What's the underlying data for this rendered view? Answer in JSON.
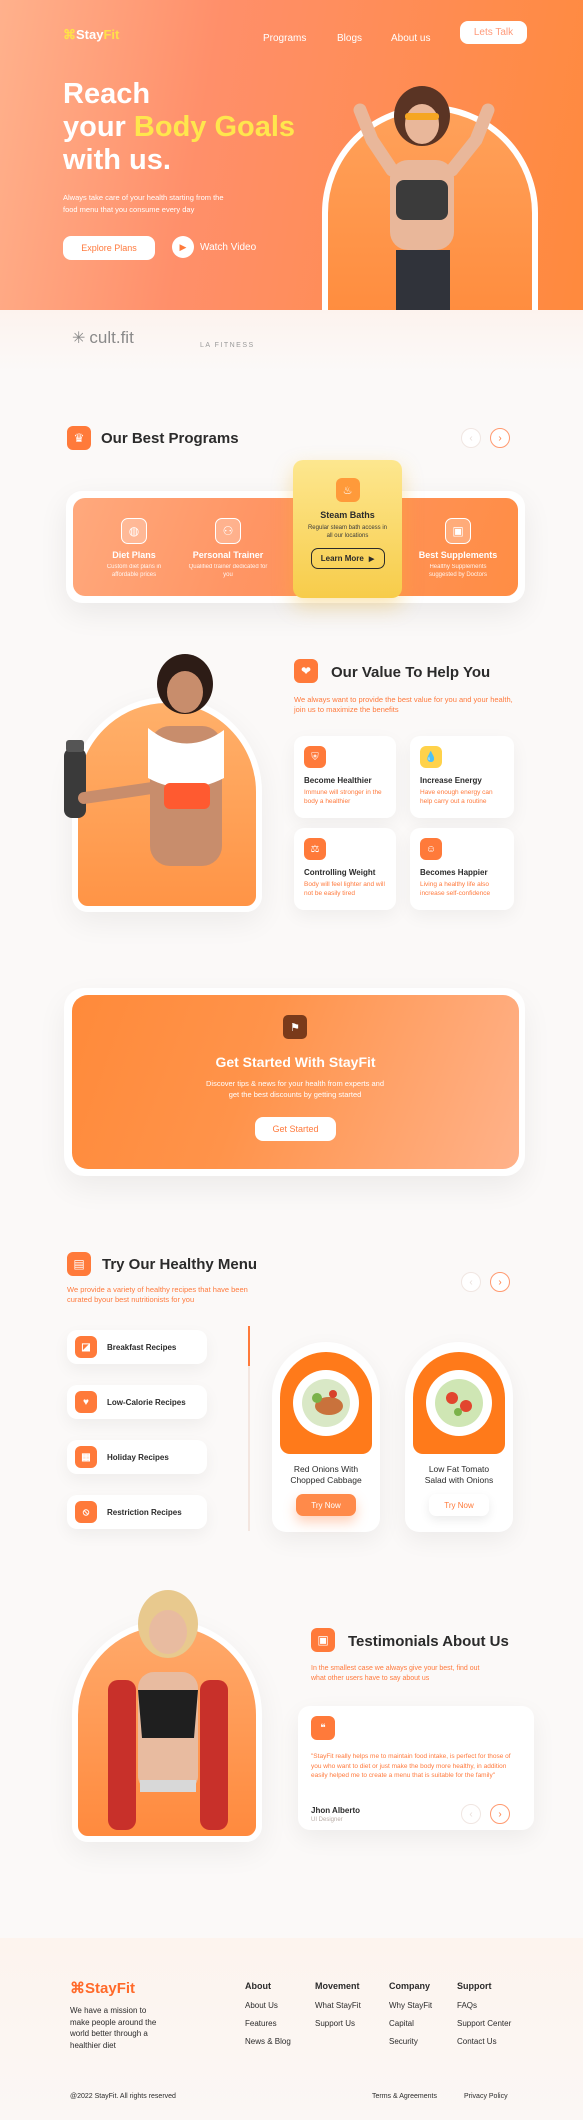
{
  "brand": {
    "logo_stay": "Stay",
    "logo_fit": "Fit"
  },
  "nav": {
    "programs": "Programs",
    "blogs": "Blogs",
    "about": "About us",
    "cta": "Lets Talk"
  },
  "hero": {
    "line1": "Reach",
    "line2_plain": "your ",
    "line2_highlight": "Body Goals",
    "line3": "with us.",
    "subtitle": "Always take care of your health starting from the food menu that you consume every day",
    "primary_btn": "Explore Plans",
    "watch_btn": "Watch Video"
  },
  "partners": [
    "cult.fit",
    "LA FITNESS"
  ],
  "programs": {
    "title": "Our Best Programs",
    "items": [
      {
        "title": "Diet Plans",
        "desc": "Custom diet plans in affordable prices",
        "icon": "bowl-icon"
      },
      {
        "title": "Personal Trainer",
        "desc": "Qualified trainer dedicated for you",
        "icon": "trainer-icon"
      },
      {
        "title": "Steam Baths",
        "desc": "Regular steam bath access in all our locations",
        "icon": "steam-icon",
        "cta": "Learn More"
      },
      {
        "title": "Best Supplements",
        "desc": "Healthy Supplements suggested by Doctors",
        "icon": "supplement-icon"
      }
    ]
  },
  "value": {
    "title": "Our Value To Help You",
    "subtitle": "We always want to provide the best value for you and your health, join us to maximize the benefits",
    "items": [
      {
        "title": "Become Healthier",
        "desc": "Immune will stronger in the body a healthier",
        "icon": "shield-icon"
      },
      {
        "title": "Increase Energy",
        "desc": "Have enough energy can help carry out a routine",
        "icon": "drop-icon"
      },
      {
        "title": "Controlling Weight",
        "desc": "Body will feel lighter and will not be easily tired",
        "icon": "scale-icon"
      },
      {
        "title": "Becomes Happier",
        "desc": "Living a healthy life also increase self-confidence",
        "icon": "smile-icon"
      }
    ]
  },
  "cta_banner": {
    "title": "Get Started With StayFit",
    "subtitle": "Discover tips & news for your health from experts and get the best discounts by getting started",
    "button": "Get Started"
  },
  "menu": {
    "title": "Try Our Healthy Menu",
    "subtitle": "We provide a variety of healthy recipes that have been curated byour best nutritionists for you",
    "categories": [
      "Breakfast Recipes",
      "Low-Calorie Recipes",
      "Holiday Recipes",
      "Restriction Recipes"
    ],
    "dishes": [
      {
        "name": "Red Onions With Chopped Cabbage",
        "button": "Try Now"
      },
      {
        "name": "Low Fat Tomato Salad with Onions",
        "button": "Try Now"
      }
    ]
  },
  "testimonials": {
    "title": "Testimonials About Us",
    "subtitle": "In the smallest case we always give your best, find out what other users have to say about us",
    "quote": "\"StayFit really helps me to maintain food intake, is perfect for those of you who want to diet or just make the body more healthy, in addition easily helped me to create a menu that is suitable for the family\"",
    "author": "Jhon Alberto",
    "role": "UI Designer"
  },
  "footer": {
    "mission": "We have a mission to make people around the world better through a healthier diet",
    "columns": [
      {
        "title": "About",
        "links": [
          "About Us",
          "Features",
          "News & Blog"
        ]
      },
      {
        "title": "Movement",
        "links": [
          "What StayFit",
          "Support Us"
        ]
      },
      {
        "title": "Company",
        "links": [
          "Why StayFit",
          "Capital",
          "Security"
        ]
      },
      {
        "title": "Support",
        "links": [
          "FAQs",
          "Support Center",
          "Contact Us"
        ]
      }
    ],
    "copyright": "@2022 StayFit. All rights reserved",
    "terms": "Terms & Agreements",
    "privacy": "Privacy Policy"
  },
  "colors": {
    "primary": "#ff7a3a",
    "accent": "#ffe04a",
    "gold": "#f8d34a"
  }
}
